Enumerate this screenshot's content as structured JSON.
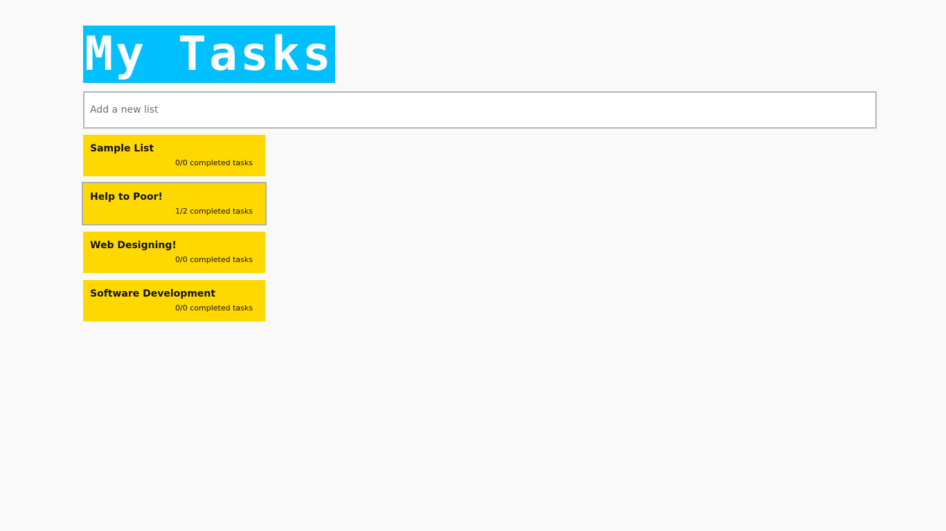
{
  "app": {
    "logo_text": "My Tasks",
    "accent_color": "#00c0ff",
    "card_color": "#ffd800"
  },
  "new_list": {
    "placeholder": "Add a new list",
    "value": ""
  },
  "lists": [
    {
      "title": "Sample List",
      "count": "0/0 completed tasks",
      "selected": false
    },
    {
      "title": "Help to Poor!",
      "count": "1/2 completed tasks",
      "selected": true
    },
    {
      "title": "Web Designing!",
      "count": "0/0 completed tasks",
      "selected": false
    },
    {
      "title": "Software Development",
      "count": "0/0 completed tasks",
      "selected": false
    }
  ]
}
